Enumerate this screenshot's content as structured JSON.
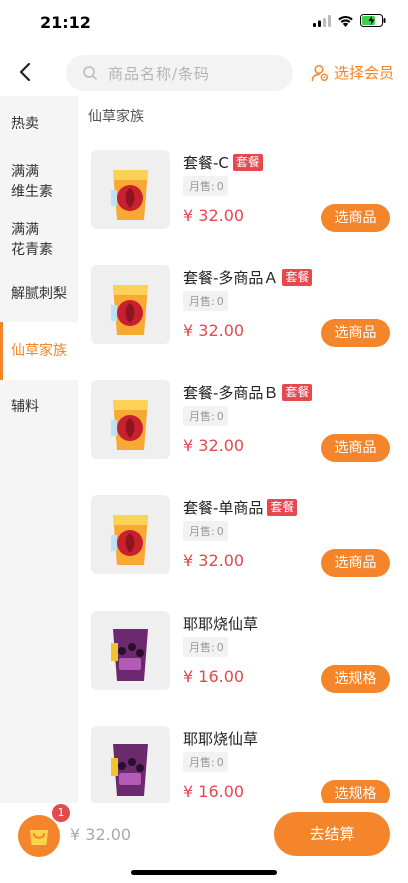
{
  "status_bar": {
    "time": "21:12"
  },
  "header": {
    "search_placeholder": "商品名称/条码",
    "member_label": "选择会员"
  },
  "sidebar": {
    "items": [
      {
        "lines": [
          "热卖"
        ],
        "active": false
      },
      {
        "lines": [
          "满满",
          "维生素"
        ],
        "active": false
      },
      {
        "lines": [
          "满满",
          "花青素"
        ],
        "active": false
      },
      {
        "lines": [
          "解腻刺梨"
        ],
        "active": false
      },
      {
        "lines": [
          "仙草家族"
        ],
        "active": true
      },
      {
        "lines": [
          "辅料"
        ],
        "active": false
      }
    ]
  },
  "section_title": "仙草家族",
  "products": [
    {
      "name": "套餐-C",
      "tag": "套餐",
      "sold_label": "月售:",
      "sold": "0",
      "price": "¥ 32.00",
      "button": "选商品",
      "image": "orange-drink"
    },
    {
      "name": "套餐-多商品Ａ",
      "tag": "套餐",
      "sold_label": "月售:",
      "sold": "0",
      "price": "¥ 32.00",
      "button": "选商品",
      "image": "orange-drink"
    },
    {
      "name": "套餐-多商品Ｂ",
      "tag": "套餐",
      "sold_label": "月售:",
      "sold": "0",
      "price": "¥ 32.00",
      "button": "选商品",
      "image": "orange-drink"
    },
    {
      "name": "套餐-单商品",
      "tag": "套餐",
      "sold_label": "月售:",
      "sold": "0",
      "price": "¥ 32.00",
      "button": "选商品",
      "image": "orange-drink"
    },
    {
      "name": "耶耶烧仙草",
      "tag": "",
      "sold_label": "月售:",
      "sold": "0",
      "price": "¥ 16.00",
      "button": "选规格",
      "image": "purple-drink"
    },
    {
      "name": "耶耶烧仙草",
      "tag": "",
      "sold_label": "月售:",
      "sold": "0",
      "price": "¥ 16.00",
      "button": "选规格",
      "image": "purple-drink"
    }
  ],
  "cart": {
    "count": "1",
    "total": "¥ 32.00",
    "checkout_label": "去结算"
  },
  "colors": {
    "accent": "#f5852a",
    "tag_red": "#e5484d",
    "price_red": "#e5484d",
    "sidebar_bg": "#f5f5f5"
  }
}
